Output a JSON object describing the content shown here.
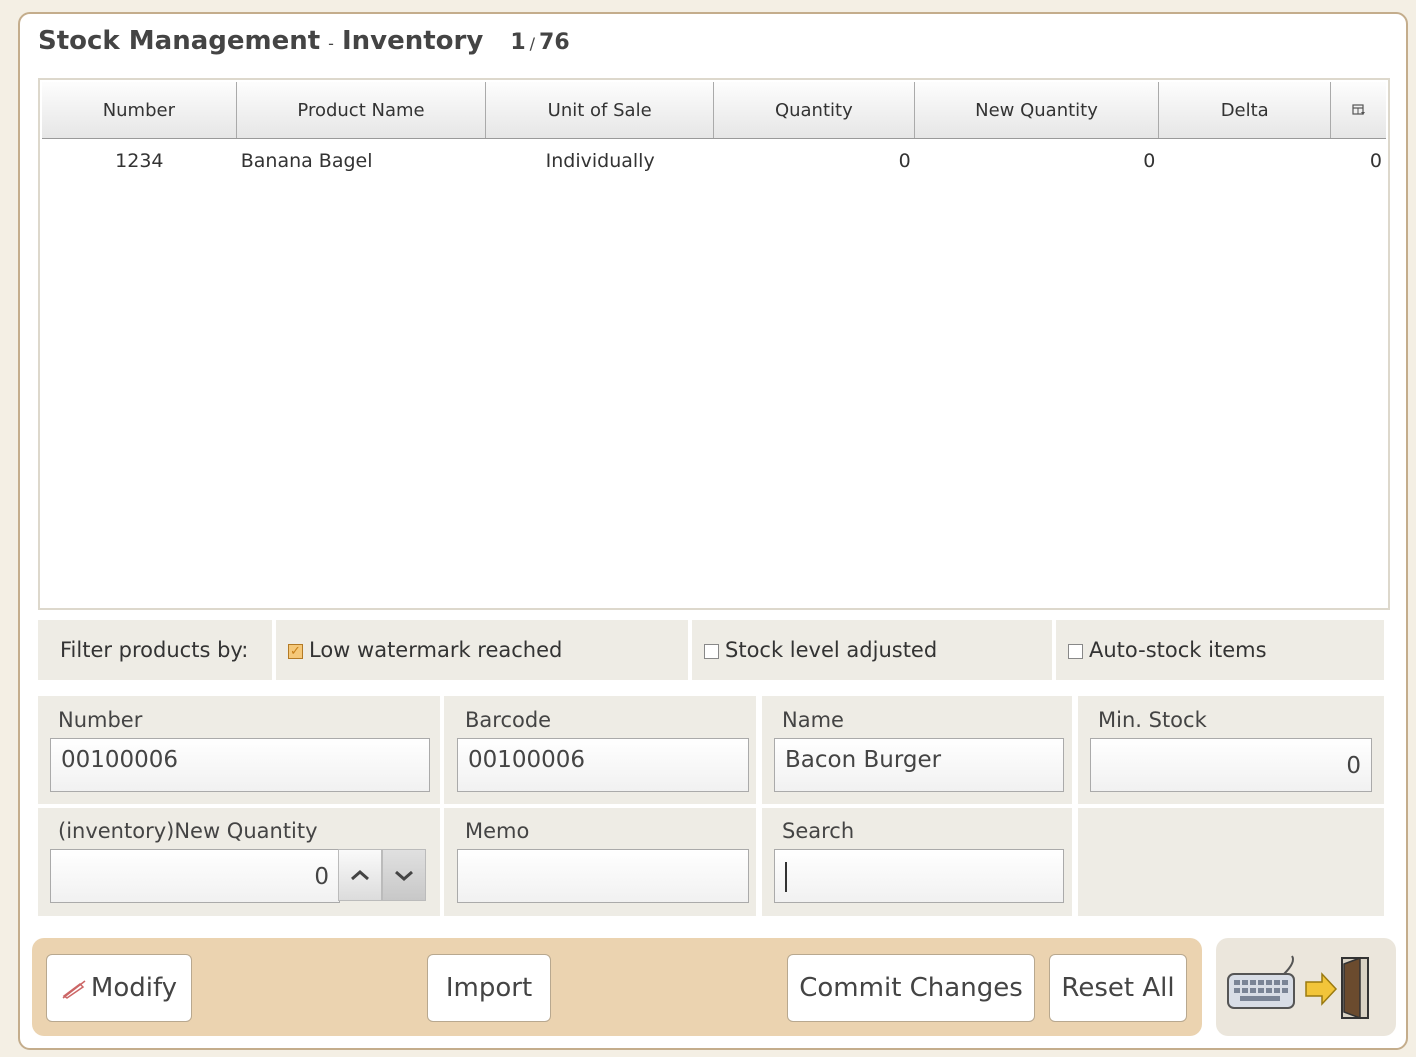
{
  "header": {
    "title": "Stock Management",
    "subtitle": "Inventory",
    "separator": "-",
    "page_current": "1",
    "page_total": "76",
    "page_sep": "/"
  },
  "table": {
    "columns": [
      "Number",
      "Product Name",
      "Unit of Sale",
      "Quantity",
      "New Quantity",
      "Delta"
    ],
    "rows": [
      {
        "number": "1234",
        "product_name": "Banana Bagel",
        "unit": "Individually",
        "quantity": "0",
        "new_quantity": "0",
        "delta": "0"
      }
    ]
  },
  "filter": {
    "label": "Filter products by:",
    "options": [
      {
        "label": "Low watermark reached",
        "checked": true
      },
      {
        "label": "Stock level adjusted",
        "checked": false
      },
      {
        "label": "Auto-stock items",
        "checked": false
      }
    ]
  },
  "form": {
    "number": {
      "label": "Number",
      "value": "00100006"
    },
    "barcode": {
      "label": "Barcode",
      "value": "00100006"
    },
    "name": {
      "label": "Name",
      "value": "Bacon Burger"
    },
    "min_stock": {
      "label": "Min. Stock",
      "value": "0"
    },
    "new_quantity": {
      "label": "(inventory)New Quantity",
      "value": "0"
    },
    "memo": {
      "label": "Memo",
      "value": ""
    },
    "search": {
      "label": "Search",
      "value": ""
    }
  },
  "actions": {
    "modify": "Modify",
    "import": "Import",
    "commit": "Commit Changes",
    "reset": "Reset All"
  },
  "colors": {
    "panel_border": "#c4ad8c",
    "action_bar": "#ebd3b0",
    "form_bg": "#eeece5",
    "checkbox_on": "#f5c879"
  }
}
